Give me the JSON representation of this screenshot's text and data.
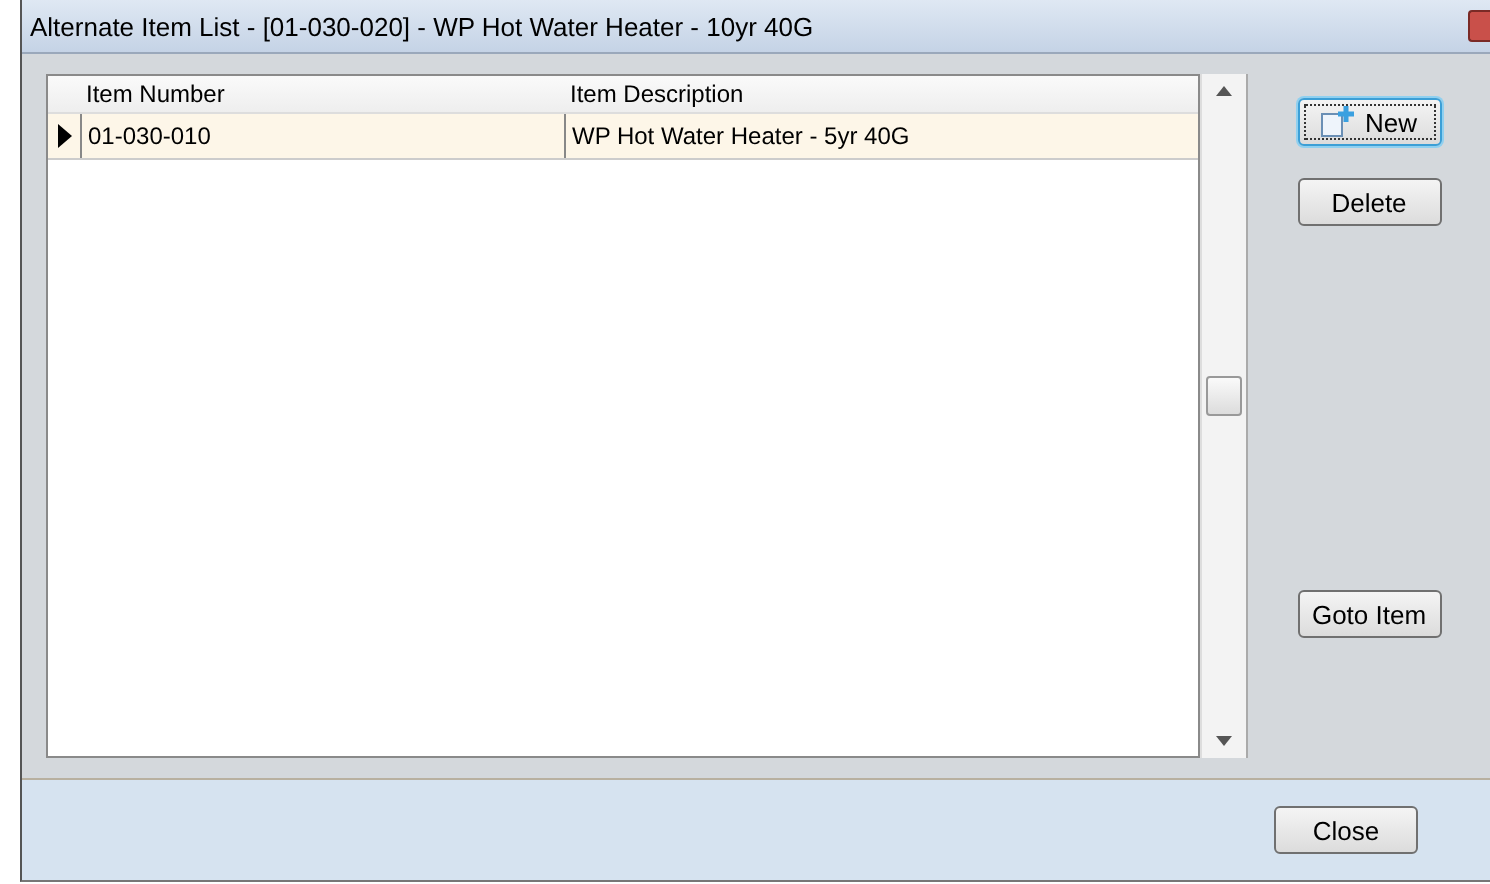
{
  "window": {
    "title": "Alternate Item List - [01-030-020] - WP Hot Water Heater - 10yr 40G"
  },
  "table": {
    "columns": [
      "Item Number",
      "Item Description"
    ],
    "rows": [
      {
        "cells": [
          "01-030-010",
          "WP Hot Water Heater - 5yr 40G"
        ],
        "selected": true
      }
    ]
  },
  "side_buttons": [
    {
      "label": "New",
      "kind": "new",
      "focused": true
    },
    {
      "label": "Delete",
      "kind": "plain",
      "focused": false
    },
    {
      "label": "Goto Item",
      "kind": "plain",
      "focused": false
    }
  ],
  "footer_buttons": [
    "Close"
  ]
}
